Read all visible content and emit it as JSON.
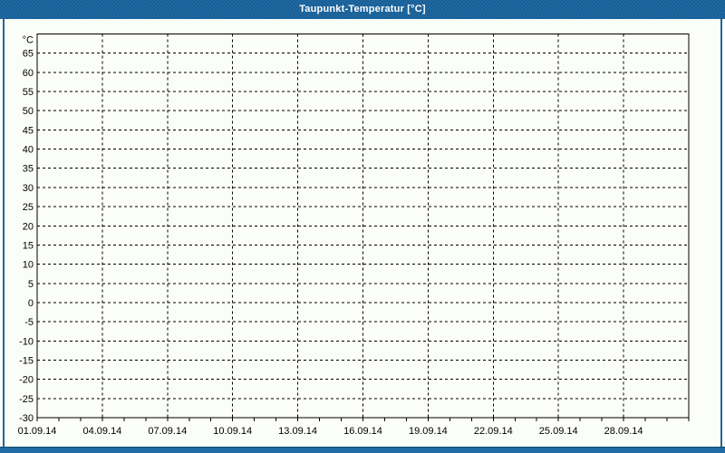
{
  "window": {
    "title": "Taupunkt-Temperatur [°C]",
    "colors": {
      "title_bar": "#1f6ba5",
      "title_bar_dots": "#1a5c90",
      "frame_border": "#2b6397",
      "background": "#fbfdf8",
      "grid_line": "#000000",
      "title_text": "#ffffff"
    }
  },
  "chart_data": {
    "type": "line",
    "title": "Taupunkt-Temperatur [°C]",
    "ylabel": "°C",
    "xlabel": "",
    "ylim": [
      -30,
      70
    ],
    "y_tick_step": 5,
    "y_tick_labels": [
      "65",
      "60",
      "55",
      "50",
      "45",
      "40",
      "35",
      "30",
      "25",
      "20",
      "15",
      "10",
      "5",
      "0",
      "-5",
      "-10",
      "-15",
      "-20",
      "-25",
      "-30"
    ],
    "x_tick_labels": [
      "01.09.14",
      "04.09.14",
      "07.09.14",
      "10.09.14",
      "13.09.14",
      "16.09.14",
      "19.09.14",
      "22.09.14",
      "25.09.14",
      "28.09.14"
    ],
    "x_range_days": 30,
    "x_label_step_days": 3,
    "x_minor_tick_days": 1,
    "grid": "dashed",
    "legend": "none",
    "series": []
  }
}
